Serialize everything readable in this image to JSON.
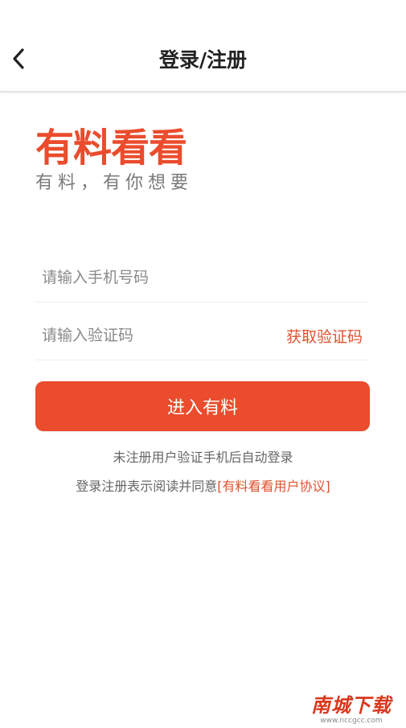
{
  "header": {
    "title": "登录/注册",
    "back_icon": "chevron-left-icon"
  },
  "brand": {
    "logo_text": "有料看看",
    "slogan": "有料，有你想要"
  },
  "form": {
    "phone_placeholder": "请输入手机号码",
    "phone_value": "",
    "code_placeholder": "请输入验证码",
    "code_value": "",
    "get_code_label": "获取验证码",
    "submit_label": "进入有料"
  },
  "notice": {
    "line1": "未注册用户验证手机后自动登录",
    "line2_prefix": "登录注册表示阅读并同意",
    "agreement_link": "[有料看看用户协议]"
  },
  "watermark": {
    "main": "南城下载",
    "sub": "www.nccgcc.com"
  },
  "colors": {
    "accent": "#ea4c2d",
    "link": "#e0512f",
    "text_primary": "#222222",
    "text_secondary": "#666666"
  }
}
